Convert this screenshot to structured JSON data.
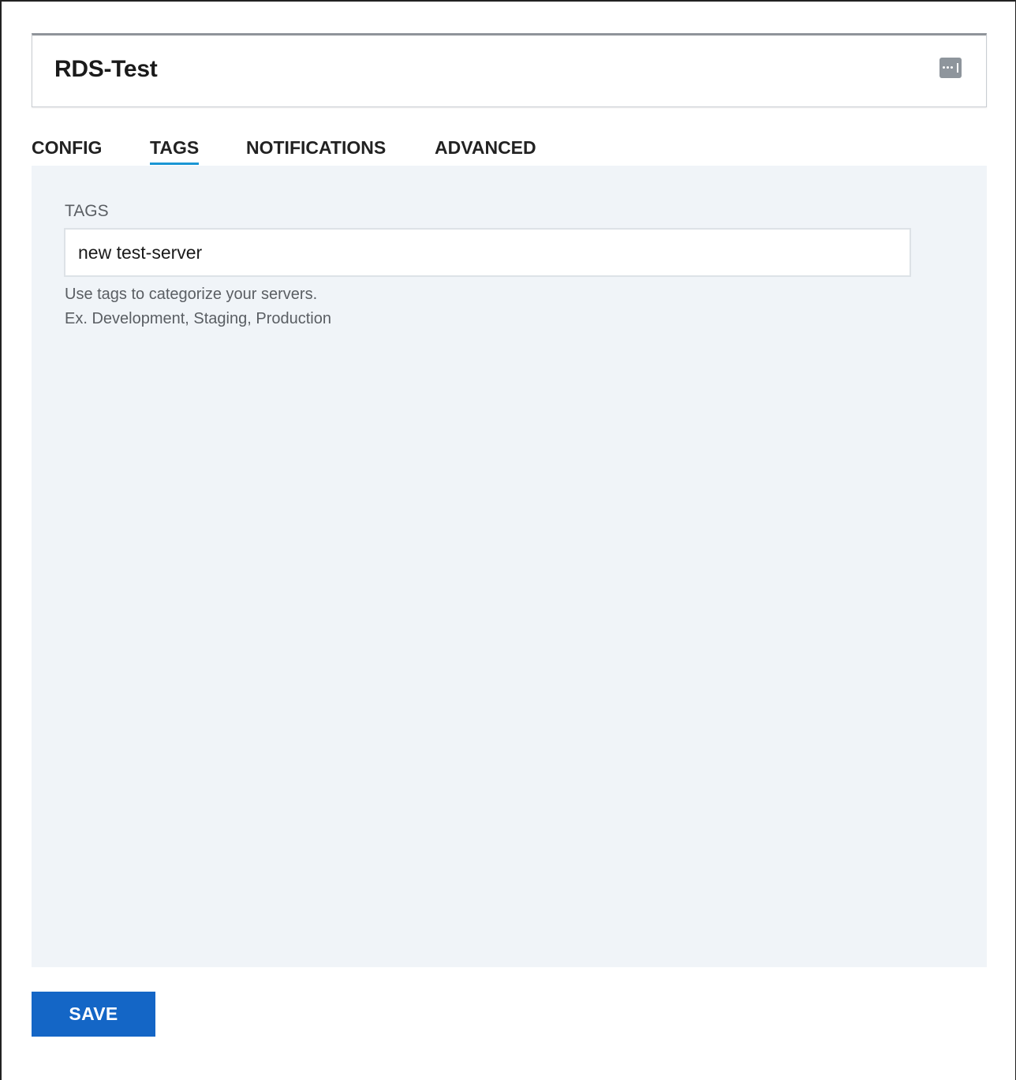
{
  "header": {
    "title": "RDS-Test",
    "menu_icon": "more-options-icon"
  },
  "tabs": [
    {
      "label": "CONFIG",
      "active": false
    },
    {
      "label": "TAGS",
      "active": true
    },
    {
      "label": "NOTIFICATIONS",
      "active": false
    },
    {
      "label": "ADVANCED",
      "active": false
    }
  ],
  "tags_panel": {
    "field_label": "TAGS",
    "input_value": "new test-server",
    "help_line_1": "Use tags to categorize your servers.",
    "help_line_2": "Ex. Development, Staging, Production"
  },
  "footer": {
    "save_label": "SAVE"
  },
  "colors": {
    "accent_underline": "#1a96d4",
    "save_button": "#1466c6",
    "panel_background": "#f0f4f8"
  }
}
